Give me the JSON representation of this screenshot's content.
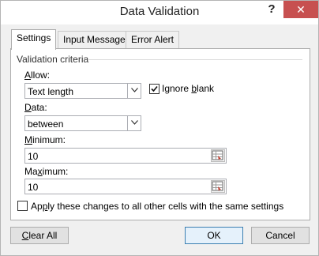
{
  "window": {
    "title": "Data Validation",
    "help": "?",
    "close": "✕"
  },
  "tabs": [
    {
      "label": "Settings"
    },
    {
      "label": "Input Message"
    },
    {
      "label": "Error Alert"
    }
  ],
  "criteria": {
    "group_label": "Validation criteria",
    "allow": {
      "label_mn": "A",
      "label_rest": "llow:",
      "value": "Text length"
    },
    "ignore_blank": {
      "label_pre": "Ignore ",
      "label_mn": "b",
      "label_rest": "lank",
      "checked": true
    },
    "data": {
      "label_mn": "D",
      "label_rest": "ata:",
      "value": "between"
    },
    "minimum": {
      "label_mn": "M",
      "label_rest": "inimum:",
      "value": "10"
    },
    "maximum": {
      "label_pre": "Ma",
      "label_mn": "x",
      "label_rest": "imum:",
      "value": "10"
    }
  },
  "apply_all": {
    "label_pre": "Ap",
    "label_mn": "p",
    "label_rest": "ly these changes to all other cells with the same settings",
    "checked": false
  },
  "buttons": {
    "clear_mn": "C",
    "clear_rest": "lear All",
    "ok": "OK",
    "cancel": "Cancel"
  },
  "icons": {
    "dropdown": "chevron-down",
    "range_picker": "cell-reference-picker"
  }
}
